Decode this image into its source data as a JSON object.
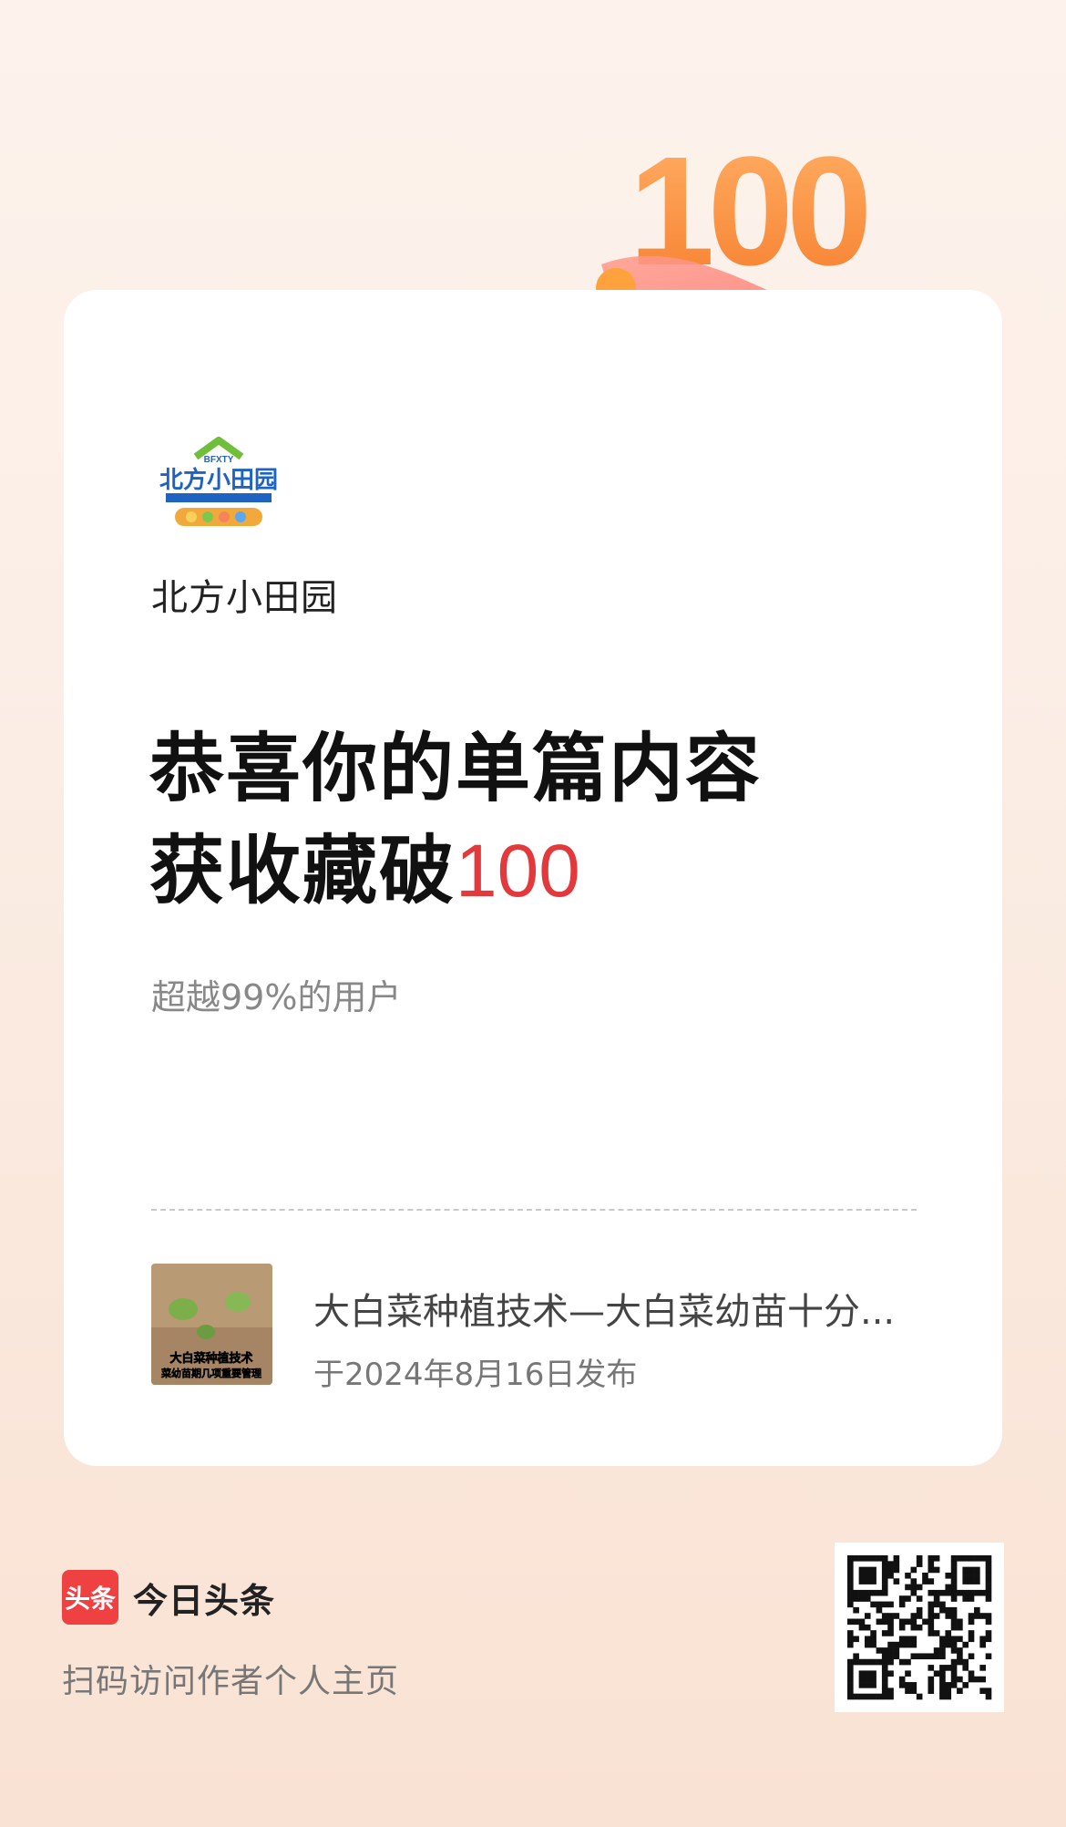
{
  "badge_number": "100",
  "author": {
    "name": "北方小田园",
    "logo_text": "北方小田园"
  },
  "headline": {
    "line1": "恭喜你的单篇内容",
    "line2_prefix": "获收藏破",
    "line2_number": "100"
  },
  "subline": "超越99%的用户",
  "article": {
    "title": "大白菜种植技术—大白菜幼苗十分...",
    "date": "于2024年8月16日发布",
    "thumb_caption_1": "大白菜种植技术",
    "thumb_caption_2": "菜幼苗期几项重要管理"
  },
  "footer": {
    "brand_badge": "头条",
    "brand_name": "今日头条",
    "tip": "扫码访问作者个人主页"
  },
  "colors": {
    "accent_red": "#e4393c",
    "brand_red": "#f04142",
    "hero_orange": "#f7923c"
  }
}
